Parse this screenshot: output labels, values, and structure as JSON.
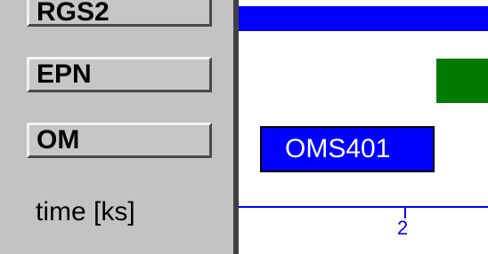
{
  "instrument_buttons": [
    {
      "label": "RGS2"
    },
    {
      "label": "EPN"
    },
    {
      "label": "OM"
    }
  ],
  "axis": {
    "label": "time [ks]",
    "ticks": [
      {
        "label": "2"
      }
    ]
  },
  "timeline": {
    "observations": [
      {
        "label": "OMS401"
      }
    ]
  },
  "colors": {
    "panel_bg": "#c3c3c3",
    "bar_blue": "#0000ff",
    "block_green": "#007a00",
    "axis_blue": "#0000ff"
  }
}
